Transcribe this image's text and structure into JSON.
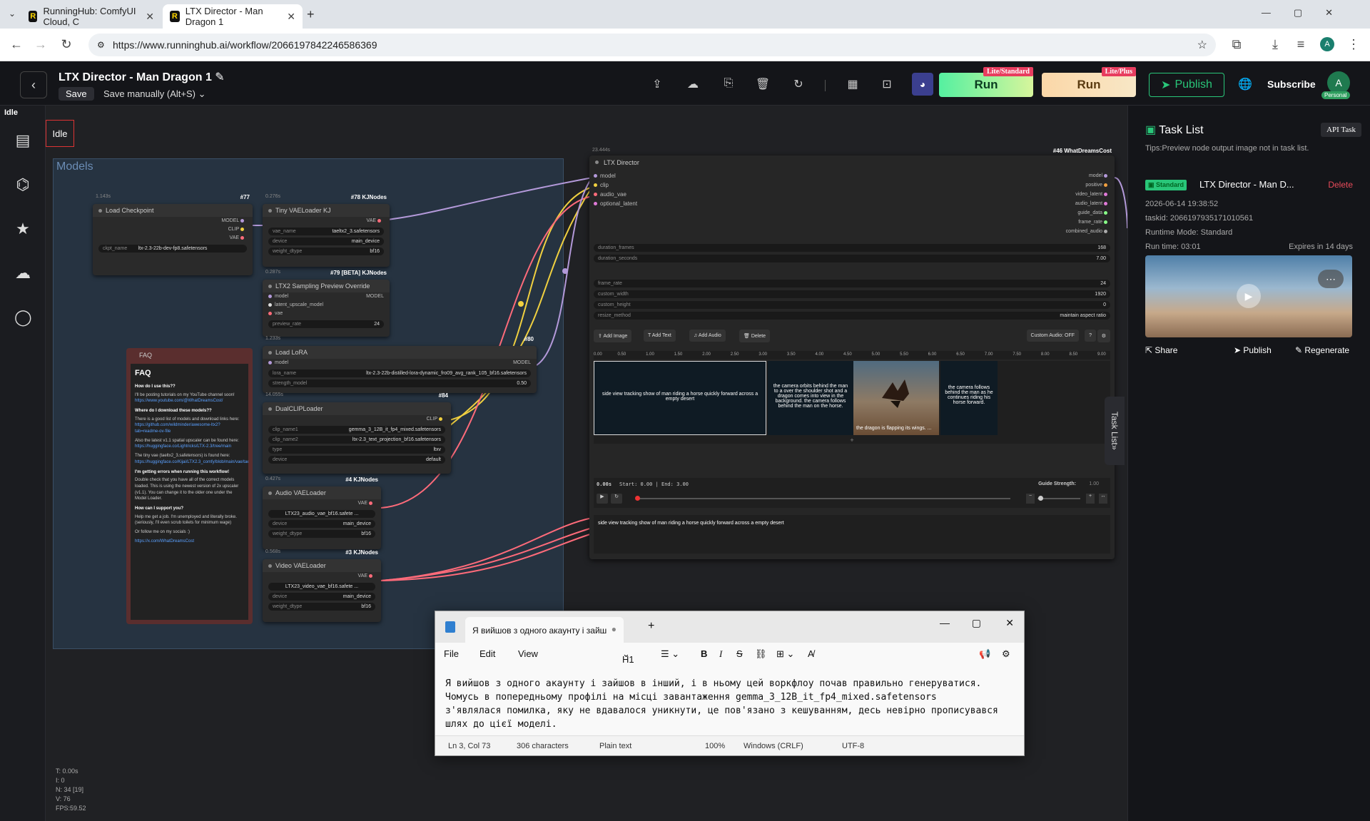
{
  "browser": {
    "tabs": [
      {
        "label": "RunningHub: ComfyUI Cloud, C",
        "favicon": "R"
      },
      {
        "label": "LTX Director - Man Dragon 1",
        "favicon": "R"
      }
    ],
    "url": "https://www.runninghub.ai/workflow/2066197842246586369"
  },
  "app": {
    "title": "LTX Director - Man Dragon 1",
    "save_label": "Save",
    "save_mode": "Save manually (Alt+S)",
    "run_standard_label": "Run",
    "run_standard_tag": "Lite/Standard",
    "run_plus_label": "Run",
    "run_plus_tag": "Lite/Plus",
    "publish_label": "Publish",
    "subscribe_label": "Subscribe",
    "avatar_letter": "A",
    "avatar_badge": "Personal",
    "status_top": "Idle",
    "status_box": "Idle"
  },
  "canvas": {
    "group_title": "Models",
    "nodes": {
      "load_checkpoint": {
        "title": "Load Checkpoint",
        "id": "#77",
        "time": "1.143s",
        "outputs": [
          "MODEL",
          "CLIP",
          "VAE"
        ],
        "ckpt_key": "ckpt_name",
        "ckpt_value": "ltx-2.3-22b-dev-fp8.safetensors"
      },
      "tiny_vae": {
        "title": "Tiny VAELoader KJ",
        "id": "#78 KJNodes",
        "time": "0.276s",
        "output": "VAE",
        "widgets": [
          {
            "k": "vae_name",
            "v": "taeltx2_3.safetensors"
          },
          {
            "k": "device",
            "v": "main_device"
          },
          {
            "k": "weight_dtype",
            "v": "bf16"
          }
        ]
      },
      "sampling_preview": {
        "title": "LTX2 Sampling Preview Override",
        "id": "#79 [BETA] KJNodes",
        "time": "0.287s",
        "inputs": [
          "model",
          "latent_upscale_model",
          "vae"
        ],
        "output": "MODEL",
        "widget_k": "preview_rate",
        "widget_v": "24"
      },
      "load_lora": {
        "title": "Load LoRA",
        "id": "#80",
        "time": "1.233s",
        "input": "model",
        "output": "MODEL",
        "widgets": [
          {
            "k": "lora_name",
            "v": "ltx-2.3-22b-distilled-lora-dynamic_fro09_avg_rank_105_bf16.safetensors"
          },
          {
            "k": "strength_model",
            "v": "0.50"
          }
        ]
      },
      "dual_clip": {
        "title": "DualCLIPLoader",
        "id": "#84",
        "time": "14.055s",
        "output": "CLIP",
        "widgets": [
          {
            "k": "clip_name1",
            "v": "gemma_3_12B_it_fp4_mixed.safetensors"
          },
          {
            "k": "clip_name2",
            "v": "ltx-2.3_text_projection_bf16.safetensors"
          },
          {
            "k": "type",
            "v": "ltxv"
          },
          {
            "k": "device",
            "v": "default"
          }
        ]
      },
      "audio_vae": {
        "title": "Audio VAELoader",
        "id": "#4 KJNodes",
        "time": "0.427s",
        "output": "VAE",
        "widgets": [
          {
            "k": "",
            "v": "LTX23_audio_vae_bf16.safete ..."
          },
          {
            "k": "device",
            "v": "main_device"
          },
          {
            "k": "weight_dtype",
            "v": "bf16"
          }
        ]
      },
      "video_vae": {
        "title": "Video VAELoader",
        "id": "#3 KJNodes",
        "time": "0.568s",
        "output": "VAE",
        "widgets": [
          {
            "k": "",
            "v": "LTX23_video_vae_bf16.safete ..."
          },
          {
            "k": "device",
            "v": "main_device"
          },
          {
            "k": "weight_dtype",
            "v": "bf16"
          }
        ]
      }
    },
    "faq": {
      "node_title": "FAQ",
      "heading": "FAQ",
      "q1": "How do I use this??",
      "a1": "I'll be posting tutorials on my YouTube channel soon!",
      "l1": "https://www.youtube.com/@WhatDreamsCost/",
      "q2": "Where do I download these models??",
      "a2": "There is a good list of models and download links here:",
      "l2": "https://github.com/wildminder/awesome-ltx2?tab=readme-ov-file",
      "a2b": "Also the latest v1.1 spatial upscaler can be found here:",
      "l2b": "https://huggingface.co/Lightricks/LTX-2.3/tree/main",
      "a2c": "The tiny vae (taeltx2_3.safetensors) is found here:",
      "l2c": "https://huggingface.co/Kijai/LTX2.3_comfy/blob/main/vae/taeltx2_3.safetensors",
      "q3": "I'm getting errors when running this workflow!",
      "a3": "Double check that you have all of the correct models loaded. This is using the newest version of 2x upscaler (v1.1). You can change it to the older one under the Model Loader.",
      "q4": "How can I support you?",
      "a4": "Help me get a job. I'm unemployed and literally broke. (seriously, I'll even scrub toilets for minimum wage)",
      "a4b": "Or follow me on my socials :)",
      "l4": "https://x.com/WhatDreamsCost"
    },
    "ltx": {
      "title": "LTX Director",
      "id": "#46 WhatDreamsCost",
      "time": "23.444s",
      "inputs": [
        "model",
        "clip",
        "audio_vae",
        "optional_latent"
      ],
      "outputs": [
        "model",
        "positive",
        "video_latent",
        "audio_latent",
        "guide_data",
        "frame_rate",
        "combined_audio"
      ],
      "widgets": [
        {
          "k": "duration_frames",
          "v": "168"
        },
        {
          "k": "duration_seconds",
          "v": "7.00"
        },
        {
          "k": "frame_rate",
          "v": "24"
        },
        {
          "k": "custom_width",
          "v": "1920"
        },
        {
          "k": "custom_height",
          "v": "0"
        },
        {
          "k": "resize_method",
          "v": "maintain aspect ratio"
        }
      ],
      "buttons": [
        "Add Image",
        "Add Text",
        "Add Audio",
        "Delete"
      ],
      "custom_audio": "Custom Audio: OFF",
      "help": "?",
      "ticks": [
        "0.00",
        "0.50",
        "1.00",
        "1.50",
        "2.00",
        "2.50",
        "3.00",
        "3.50",
        "4.00",
        "4.50",
        "5.00",
        "5.50",
        "6.00",
        "6.50",
        "7.00",
        "7.50",
        "8.00",
        "8.50",
        "9.00"
      ],
      "clip1": "side view tracking show of man riding a horse quickly forward across a empty desert",
      "clip2": "the camera orbits behind the man to a over the shoulder shot and a dragon comes into view in the background. the camera follows behind the man on the horse.",
      "clip3": "the dragon is flapping its wings. ...",
      "clip4": "the camera follows behind the man as he continues riding his horse forward.",
      "add_track": "+",
      "time_now": "0.00s",
      "start_end": "Start: 0.00 | End: 3.00",
      "guide_label": "Guide Strength:",
      "guide_value": "1.00",
      "prompt": "side view tracking show of man riding a horse quickly forward across a empty desert"
    },
    "stats": [
      "T: 0.00s",
      "I: 0",
      "N: 34 [19]",
      "V: 76",
      "FPS:59.52"
    ]
  },
  "tasks": {
    "title": "Task List",
    "api_label": "API Task",
    "tips": "Tips:Preview node output image not in task list.",
    "badge": "Standard",
    "item_title": "LTX Director - Man D...",
    "delete_label": "Delete",
    "datetime": "2026-06-14 19:38:52",
    "taskid": "taskid: 2066197935171010561",
    "mode": "Runtime Mode: Standard",
    "runtime": "Run time: 03:01",
    "expires": "Expires in 14 days",
    "share": "Share",
    "publish": "Publish",
    "regenerate": "Regenerate",
    "side_tab": "Task List"
  },
  "notepad": {
    "tab_title": "Я вийшов з одного акаунту і зайш",
    "menu": [
      "File",
      "Edit",
      "View"
    ],
    "heading_btn": "H1",
    "text": "Я вийшов з одного акаунту і зайшов в інший, і в ньому цей воркфлоу почав правильно генеруватися.\nЧомусь в попередньому профілі на місці завантаження gemma_3_12B_it_fp4_mixed.safetensors\nз'являлася помилка, яку не вдавалося уникнути, це пов'язано з кешуванням, десь невірно прописувався\nшлях до цієї моделі.",
    "status": {
      "pos": "Ln 3, Col 73",
      "chars": "306 characters",
      "format": "Plain text",
      "zoom": "100%",
      "eol": "Windows (CRLF)",
      "enc": "UTF-8"
    }
  },
  "colors": {
    "accent_green": "#29c679",
    "run_green": "#55f0a0",
    "run_peach": "#fbd7a8",
    "tag_red": "#e83d5f",
    "link_red": "#e94b5a"
  }
}
